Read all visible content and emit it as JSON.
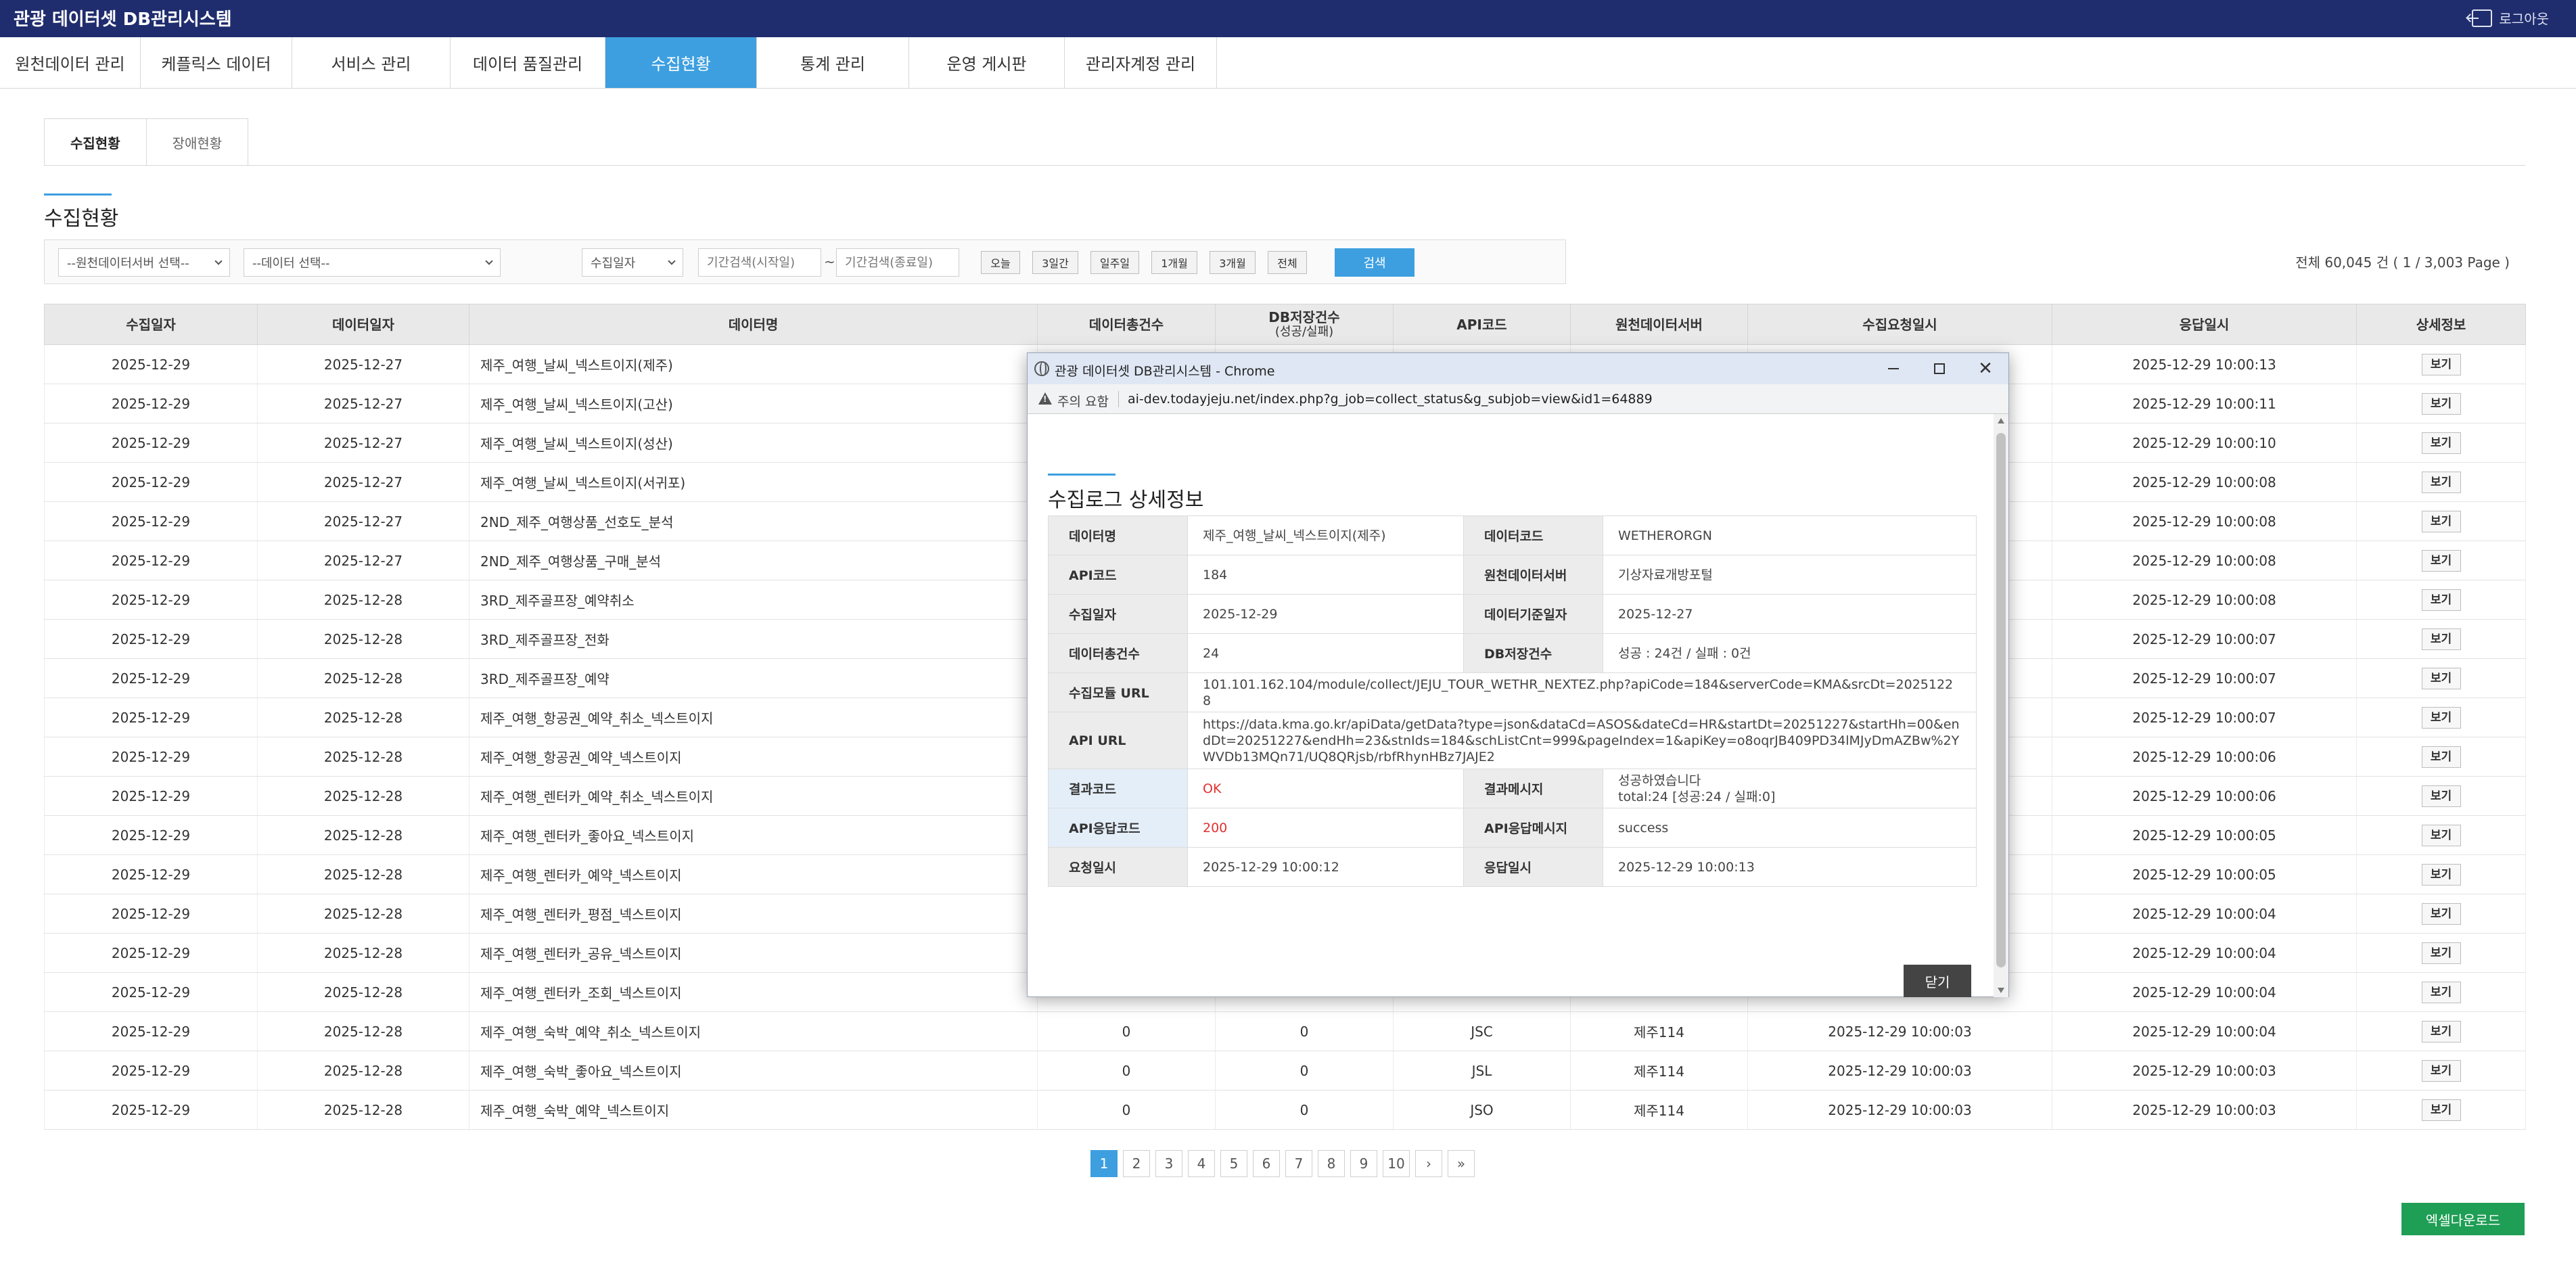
{
  "header": {
    "title": "관광 데이터셋 DB관리시스템",
    "logout": "로그아웃"
  },
  "nav": [
    {
      "label": "원천데이터 관리"
    },
    {
      "label": "케플릭스 데이터"
    },
    {
      "label": "서비스 관리"
    },
    {
      "label": "데이터 품질관리"
    },
    {
      "label": "수집현황"
    },
    {
      "label": "통계 관리"
    },
    {
      "label": "운영 게시판"
    },
    {
      "label": "관리자계정 관리"
    }
  ],
  "subtabs": [
    {
      "label": "수집현황"
    },
    {
      "label": "장애현황"
    }
  ],
  "section_title": "수집현황",
  "search": {
    "server_select": "--원천데이터서버 선택--",
    "data_select": "--데이터 선택--",
    "date_type_select": "수집일자",
    "start_placeholder": "기간검색(시작일)",
    "end_placeholder": "기간검색(종료일)",
    "tilde": "~",
    "quick": [
      "오늘",
      "3일간",
      "일주일",
      "1개월",
      "3개월",
      "전체"
    ],
    "search_button": "검색"
  },
  "total_info": "전체 60,045 건 ( 1 / 3,003 Page )",
  "table": {
    "headers": {
      "col0": "수집일자",
      "col1": "데이터일자",
      "col2": "데이터명",
      "col3": "데이터총건수",
      "col4": "DB저장건수",
      "col4_sub": "(성공/실패)",
      "col5": "API코드",
      "col6": "원천데이터서버",
      "col7": "수집요청일시",
      "col8": "응답일시",
      "col9": "상세정보"
    },
    "view_label": "보기",
    "rows": [
      {
        "collect_date": "2025-12-29",
        "data_date": "2025-12-27",
        "name": "제주_여행_날씨_넥스트이지(제주)",
        "total": "",
        "saved": "",
        "api": "",
        "server": "",
        "req": "",
        "resp": "2025-12-29 10:00:13"
      },
      {
        "collect_date": "2025-12-29",
        "data_date": "2025-12-27",
        "name": "제주_여행_날씨_넥스트이지(고산)",
        "total": "",
        "saved": "",
        "api": "",
        "server": "",
        "req": "",
        "resp": "2025-12-29 10:00:11"
      },
      {
        "collect_date": "2025-12-29",
        "data_date": "2025-12-27",
        "name": "제주_여행_날씨_넥스트이지(성산)",
        "total": "",
        "saved": "",
        "api": "",
        "server": "",
        "req": "",
        "resp": "2025-12-29 10:00:10"
      },
      {
        "collect_date": "2025-12-29",
        "data_date": "2025-12-27",
        "name": "제주_여행_날씨_넥스트이지(서귀포)",
        "total": "",
        "saved": "",
        "api": "",
        "server": "",
        "req": "",
        "resp": "2025-12-29 10:00:08"
      },
      {
        "collect_date": "2025-12-29",
        "data_date": "2025-12-27",
        "name": "2ND_제주_여행상품_선호도_분석",
        "total": "",
        "saved": "",
        "api": "",
        "server": "",
        "req": "",
        "resp": "2025-12-29 10:00:08"
      },
      {
        "collect_date": "2025-12-29",
        "data_date": "2025-12-27",
        "name": "2ND_제주_여행상품_구매_분석",
        "total": "",
        "saved": "",
        "api": "",
        "server": "",
        "req": "",
        "resp": "2025-12-29 10:00:08"
      },
      {
        "collect_date": "2025-12-29",
        "data_date": "2025-12-28",
        "name": "3RD_제주골프장_예약취소",
        "total": "",
        "saved": "",
        "api": "",
        "server": "",
        "req": "",
        "resp": "2025-12-29 10:00:08"
      },
      {
        "collect_date": "2025-12-29",
        "data_date": "2025-12-28",
        "name": "3RD_제주골프장_전화",
        "total": "",
        "saved": "",
        "api": "",
        "server": "",
        "req": "",
        "resp": "2025-12-29 10:00:07"
      },
      {
        "collect_date": "2025-12-29",
        "data_date": "2025-12-28",
        "name": "3RD_제주골프장_예약",
        "total": "",
        "saved": "",
        "api": "",
        "server": "",
        "req": "",
        "resp": "2025-12-29 10:00:07"
      },
      {
        "collect_date": "2025-12-29",
        "data_date": "2025-12-28",
        "name": "제주_여행_항공권_예약_취소_넥스트이지",
        "total": "",
        "saved": "",
        "api": "",
        "server": "",
        "req": "",
        "resp": "2025-12-29 10:00:07"
      },
      {
        "collect_date": "2025-12-29",
        "data_date": "2025-12-28",
        "name": "제주_여행_항공권_예약_넥스트이지",
        "total": "",
        "saved": "",
        "api": "",
        "server": "",
        "req": "",
        "resp": "2025-12-29 10:00:06"
      },
      {
        "collect_date": "2025-12-29",
        "data_date": "2025-12-28",
        "name": "제주_여행_렌터카_예약_취소_넥스트이지",
        "total": "",
        "saved": "",
        "api": "",
        "server": "",
        "req": "",
        "resp": "2025-12-29 10:00:06"
      },
      {
        "collect_date": "2025-12-29",
        "data_date": "2025-12-28",
        "name": "제주_여행_렌터카_좋아요_넥스트이지",
        "total": "",
        "saved": "",
        "api": "",
        "server": "",
        "req": "",
        "resp": "2025-12-29 10:00:05"
      },
      {
        "collect_date": "2025-12-29",
        "data_date": "2025-12-28",
        "name": "제주_여행_렌터카_예약_넥스트이지",
        "total": "",
        "saved": "",
        "api": "",
        "server": "",
        "req": "",
        "resp": "2025-12-29 10:00:05"
      },
      {
        "collect_date": "2025-12-29",
        "data_date": "2025-12-28",
        "name": "제주_여행_렌터카_평점_넥스트이지",
        "total": "",
        "saved": "",
        "api": "",
        "server": "",
        "req": "",
        "resp": "2025-12-29 10:00:04"
      },
      {
        "collect_date": "2025-12-29",
        "data_date": "2025-12-28",
        "name": "제주_여행_렌터카_공유_넥스트이지",
        "total": "",
        "saved": "",
        "api": "",
        "server": "",
        "req": "",
        "resp": "2025-12-29 10:00:04"
      },
      {
        "collect_date": "2025-12-29",
        "data_date": "2025-12-28",
        "name": "제주_여행_렌터카_조회_넥스트이지",
        "total": "",
        "saved": "",
        "api": "",
        "server": "",
        "req": "",
        "resp": "2025-12-29 10:00:04"
      },
      {
        "collect_date": "2025-12-29",
        "data_date": "2025-12-28",
        "name": "제주_여행_숙박_예약_취소_넥스트이지",
        "total": "0",
        "saved": "0",
        "api": "JSC",
        "server": "제주114",
        "req": "2025-12-29 10:00:03",
        "resp": "2025-12-29 10:00:04"
      },
      {
        "collect_date": "2025-12-29",
        "data_date": "2025-12-28",
        "name": "제주_여행_숙박_좋아요_넥스트이지",
        "total": "0",
        "saved": "0",
        "api": "JSL",
        "server": "제주114",
        "req": "2025-12-29 10:00:03",
        "resp": "2025-12-29 10:00:03"
      },
      {
        "collect_date": "2025-12-29",
        "data_date": "2025-12-28",
        "name": "제주_여행_숙박_예약_넥스트이지",
        "total": "0",
        "saved": "0",
        "api": "JSO",
        "server": "제주114",
        "req": "2025-12-29 10:00:03",
        "resp": "2025-12-29 10:00:03"
      }
    ]
  },
  "pagination": {
    "pages": [
      "1",
      "2",
      "3",
      "4",
      "5",
      "6",
      "7",
      "8",
      "9",
      "10"
    ],
    "next": "›",
    "last": "»",
    "active": "1"
  },
  "excel_button": "엑셀다운로드",
  "popup": {
    "window_title": "관광 데이터셋 DB관리시스템 - Chrome",
    "warning_label": "주의 요함",
    "url": "ai-dev.todayjeju.net/index.php?g_job=collect_status&g_subjob=view&id1=64889",
    "title": "수집로그 상세정보",
    "fields": {
      "data_name_label": "데이터명",
      "data_name": "제주_여행_날씨_넥스트이지(제주)",
      "data_code_label": "데이터코드",
      "data_code": "WETHERORGN",
      "api_code_label": "API코드",
      "api_code": "184",
      "source_server_label": "원천데이터서버",
      "source_server": "기상자료개방포털",
      "collect_date_label": "수집일자",
      "collect_date": "2025-12-29",
      "base_date_label": "데이터기준일자",
      "base_date": "2025-12-27",
      "total_label": "데이터총건수",
      "total": "24",
      "db_saved_label": "DB저장건수",
      "db_saved": "성공 : 24건 / 실패 : 0건",
      "module_url_label": "수집모듈 URL",
      "module_url": "101.101.162.104/module/collect/JEJU_TOUR_WETHR_NEXTEZ.php?apiCode=184&serverCode=KMA&srcDt=20251228",
      "api_url_label": "API URL",
      "api_url": "https://data.kma.go.kr/apiData/getData?type=json&dataCd=ASOS&dateCd=HR&startDt=20251227&startHh=00&endDt=20251227&endHh=23&stnIds=184&schListCnt=999&pageIndex=1&apiKey=o8oqrJB409PD34lMJyDmAZBw%2YWVDb13MQn71/UQ8QRjsb/rbfRhynHBz7JAJE2",
      "result_code_label": "결과코드",
      "result_code": "OK",
      "result_msg_label": "결과메시지",
      "result_msg_line1": "성공하였습니다",
      "result_msg_line2": "total:24 [성공:24 / 실패:0]",
      "api_resp_code_label": "API응답코드",
      "api_resp_code": "200",
      "api_resp_msg_label": "API응답메시지",
      "api_resp_msg": "success",
      "request_time_label": "요청일시",
      "request_time": "2025-12-29 10:00:12",
      "response_time_label": "응답일시",
      "response_time": "2025-12-29 10:00:13"
    },
    "close_button": "닫기"
  }
}
